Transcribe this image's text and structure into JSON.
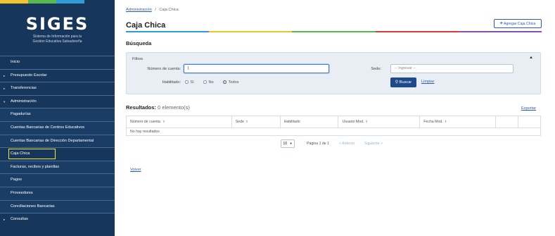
{
  "colors": {
    "sidebar_bg": "#16365c",
    "accent_blue": "#1d4a8a",
    "highlight": "#f0e832",
    "rainbow": [
      "#2e9ad6",
      "#f2c12e",
      "#57b84d",
      "#d93b3b",
      "#8e4fb0"
    ]
  },
  "sidebar": {
    "logo_title": "SIGES",
    "logo_subtitle_1": "Sistema de Información para la",
    "logo_subtitle_2": "Gestión Educativa Salvadoreña",
    "items": [
      {
        "label": "Inicio",
        "arrow": ""
      },
      {
        "label": "Presupuesto Escolar",
        "arrow": "▸"
      },
      {
        "label": "Transferencias",
        "arrow": "▸"
      },
      {
        "label": "Administración",
        "arrow": "▾"
      },
      {
        "label": "Pagadurías",
        "arrow": ""
      },
      {
        "label": "Cuentas Bancarias de Centros Educativos",
        "arrow": ""
      },
      {
        "label": "Cuentas Bancarias de Dirección Departamental",
        "arrow": ""
      },
      {
        "label": "Caja Chica",
        "arrow": ""
      },
      {
        "label": "Facturas, recibos y planillas",
        "arrow": ""
      },
      {
        "label": "Pagos",
        "arrow": ""
      },
      {
        "label": "Proveedores",
        "arrow": ""
      },
      {
        "label": "Conciliaciones Bancarias",
        "arrow": ""
      },
      {
        "label": "Consultas",
        "arrow": "▸"
      }
    ]
  },
  "breadcrumb": {
    "parent": "Administración",
    "separator": "/",
    "current": "Caja Chica"
  },
  "page": {
    "title": "Caja Chica",
    "add_button": "Agregar Caja Chica",
    "add_icon": "plus-icon"
  },
  "search": {
    "heading": "Búsqueda",
    "filters_title": "Filtros",
    "numero_label": "Número de cuenta:",
    "numero_value": "|",
    "sede_label": "Sede:",
    "sede_placeholder": "-- Ingresar --",
    "habilitado_label": "Habilitado:",
    "radio_options": [
      {
        "label": "Sí",
        "selected": false
      },
      {
        "label": "No",
        "selected": false
      },
      {
        "label": "Todos",
        "selected": true
      }
    ],
    "buscar_label": "Buscar",
    "limpiar_label": "Limpiar"
  },
  "results": {
    "title": "Resultados:",
    "count": "0 elemento(s)",
    "exportar": "Exportar",
    "columns": [
      "Número de cuenta:",
      "Sede",
      "Habilitado",
      "Usuario Mod.",
      "Fecha Mod.",
      "",
      ""
    ],
    "empty_text": "No hay resultados"
  },
  "pagination": {
    "page_size": "10",
    "page_info": "Página 1 de 1",
    "prev": "< Anterior",
    "next": "Siguiente >"
  },
  "footer": {
    "volver": "Volver"
  }
}
